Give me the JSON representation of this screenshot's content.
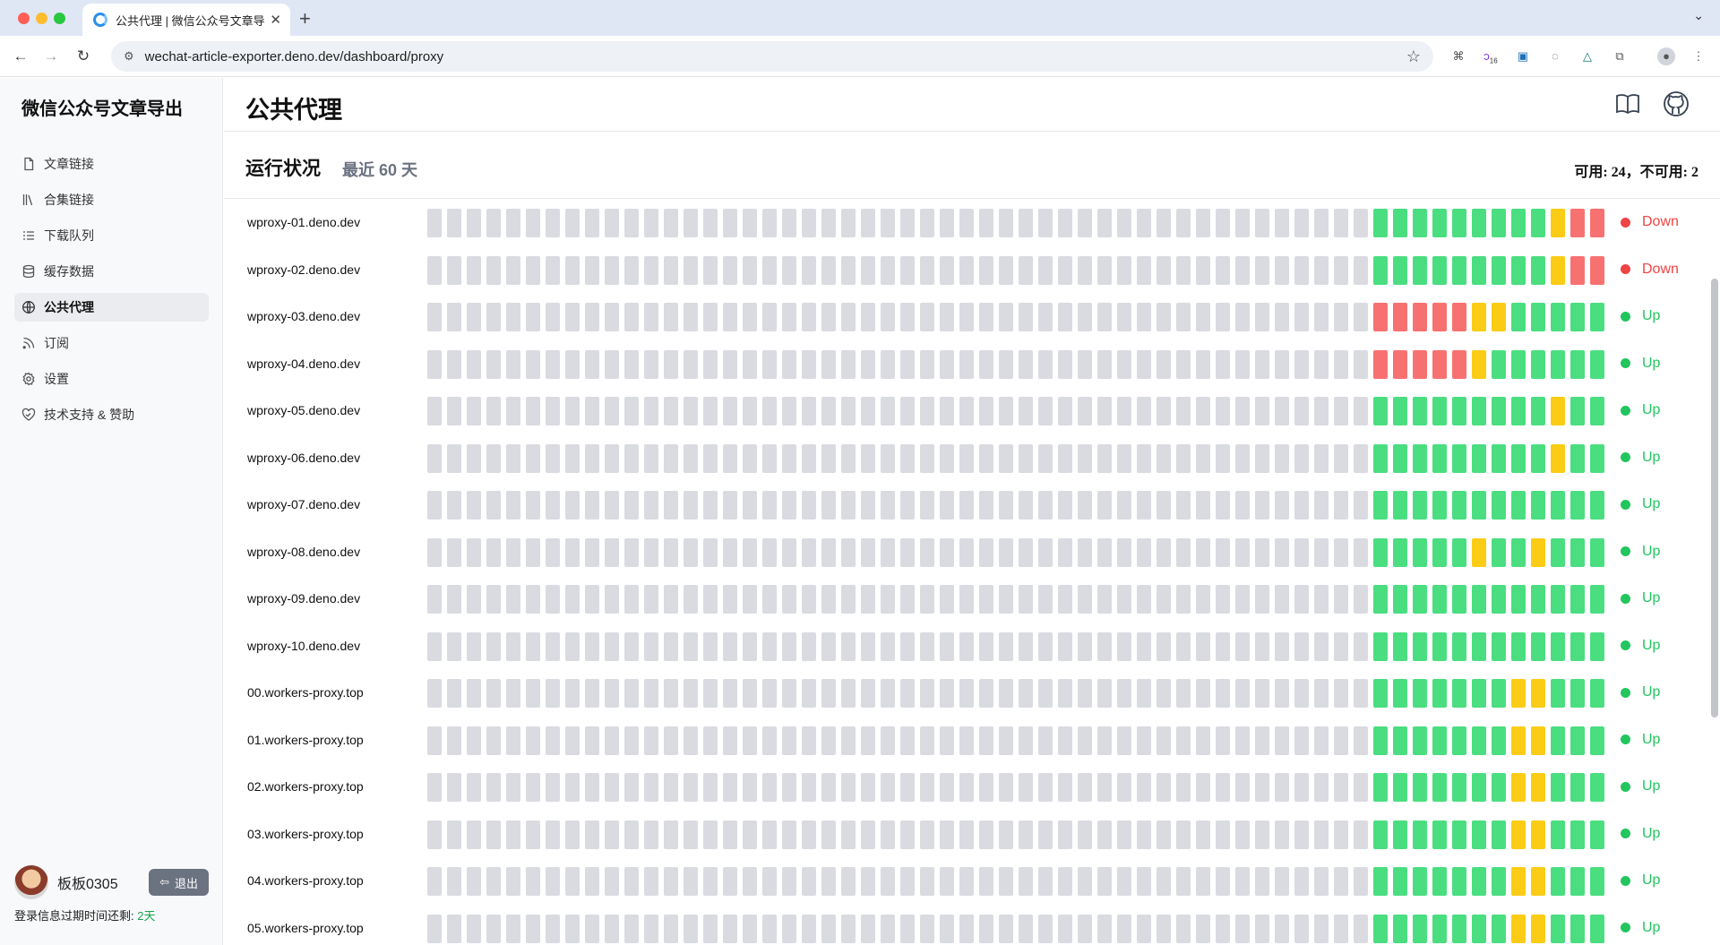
{
  "browser": {
    "tab_title": "公共代理 | 微信公众号文章导出",
    "url": "wechat-article-exporter.deno.dev/dashboard/proxy",
    "extension_badge": "16"
  },
  "sidebar": {
    "brand": "微信公众号文章导出",
    "items": [
      {
        "label": "文章链接",
        "icon": "document-icon",
        "active": false
      },
      {
        "label": "合集链接",
        "icon": "books-icon",
        "active": false
      },
      {
        "label": "下载队列",
        "icon": "list-icon",
        "active": false
      },
      {
        "label": "缓存数据",
        "icon": "database-icon",
        "active": false
      },
      {
        "label": "公共代理",
        "icon": "globe-icon",
        "active": true
      },
      {
        "label": "订阅",
        "icon": "rss-icon",
        "active": false
      },
      {
        "label": "设置",
        "icon": "gear-icon",
        "active": false
      },
      {
        "label": "技术支持 & 赞助",
        "icon": "heart-handshake-icon",
        "active": false
      }
    ],
    "username": "板板0305",
    "logout_label": "退出",
    "expiry_label": "登录信息过期时间还剩:",
    "expiry_days": "2天"
  },
  "main": {
    "title": "公共代理",
    "section_title": "运行状况",
    "section_subtitle": "最近 60 天",
    "stats": "可用: 24，不可用: 2"
  },
  "colors": {
    "up": "#22c55e",
    "down": "#ef4444",
    "bar_green": "#4ade80",
    "bar_yellow": "#facc15",
    "bar_red": "#f87171",
    "bar_empty": "#d9dbe1"
  },
  "proxies": [
    {
      "host": "wproxy-01.deno.dev",
      "status": "Down",
      "recent": "gggggggggyrr"
    },
    {
      "host": "wproxy-02.deno.dev",
      "status": "Down",
      "recent": "gggggggggyrr"
    },
    {
      "host": "wproxy-03.deno.dev",
      "status": "Up",
      "recent": "rrrrryyggggg"
    },
    {
      "host": "wproxy-04.deno.dev",
      "status": "Up",
      "recent": "rrrrrygggggg"
    },
    {
      "host": "wproxy-05.deno.dev",
      "status": "Up",
      "recent": "gggggggggygg"
    },
    {
      "host": "wproxy-06.deno.dev",
      "status": "Up",
      "recent": "gggggggggygg"
    },
    {
      "host": "wproxy-07.deno.dev",
      "status": "Up",
      "recent": "gggggggggggg"
    },
    {
      "host": "wproxy-08.deno.dev",
      "status": "Up",
      "recent": "gggggyggyggg"
    },
    {
      "host": "wproxy-09.deno.dev",
      "status": "Up",
      "recent": "gggggggggggg"
    },
    {
      "host": "wproxy-10.deno.dev",
      "status": "Up",
      "recent": "gggggggggggg"
    },
    {
      "host": "00.workers-proxy.top",
      "status": "Up",
      "recent": "gggggggyyggg"
    },
    {
      "host": "01.workers-proxy.top",
      "status": "Up",
      "recent": "gggggggyyggg"
    },
    {
      "host": "02.workers-proxy.top",
      "status": "Up",
      "recent": "gggggggyyggg"
    },
    {
      "host": "03.workers-proxy.top",
      "status": "Up",
      "recent": "gggggggyyggg"
    },
    {
      "host": "04.workers-proxy.top",
      "status": "Up",
      "recent": "gggggggyyggg"
    },
    {
      "host": "05.workers-proxy.top",
      "status": "Up",
      "recent": "gggggggyyggg"
    }
  ]
}
